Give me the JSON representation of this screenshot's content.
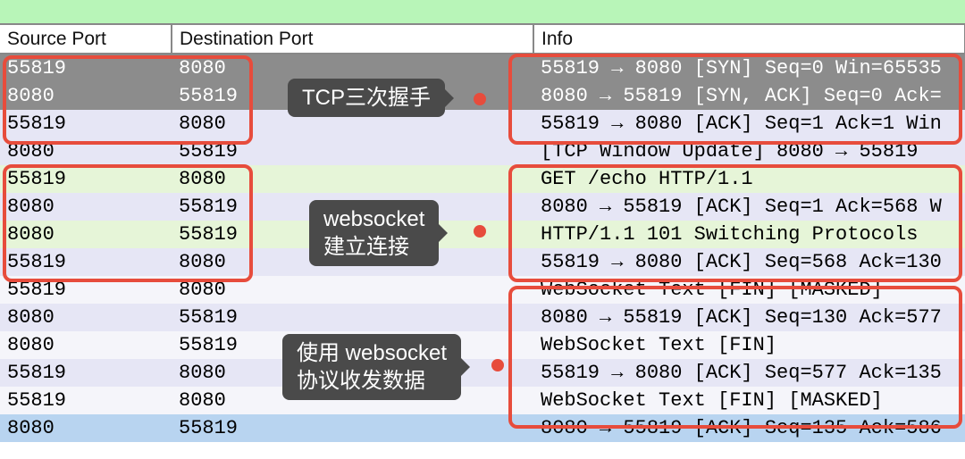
{
  "columns": {
    "src": "Source Port",
    "dst": "Destination Port",
    "info": "Info"
  },
  "rows": [
    {
      "src": "55819",
      "dst": "8080",
      "info": "55819 → 8080 [SYN] Seq=0 Win=65535",
      "cls": "selected"
    },
    {
      "src": "8080",
      "dst": "55819",
      "info": "8080 → 55819 [SYN, ACK] Seq=0 Ack=",
      "cls": "selected"
    },
    {
      "src": "55819",
      "dst": "8080",
      "info": "55819 → 8080 [ACK] Seq=1 Ack=1 Win",
      "cls": "light-lav"
    },
    {
      "src": "8080",
      "dst": "55819",
      "info": "[TCP Window Update] 8080 → 55819",
      "cls": "light-lav"
    },
    {
      "src": "55819",
      "dst": "8080",
      "info": "GET /echo HTTP/1.1",
      "cls": "light-green"
    },
    {
      "src": "8080",
      "dst": "55819",
      "info": "8080 → 55819 [ACK] Seq=1 Ack=568 W",
      "cls": "light-lav"
    },
    {
      "src": "8080",
      "dst": "55819",
      "info": "HTTP/1.1 101 Switching Protocols",
      "cls": "light-green"
    },
    {
      "src": "55819",
      "dst": "8080",
      "info": "55819 → 8080 [ACK] Seq=568 Ack=130",
      "cls": "light-lav"
    },
    {
      "src": "55819",
      "dst": "8080",
      "info": "WebSocket Text [FIN] [MASKED]",
      "cls": "alt"
    },
    {
      "src": "8080",
      "dst": "55819",
      "info": "8080 → 55819 [ACK] Seq=130 Ack=577",
      "cls": "light-lav"
    },
    {
      "src": "8080",
      "dst": "55819",
      "info": "WebSocket Text [FIN]",
      "cls": "alt"
    },
    {
      "src": "55819",
      "dst": "8080",
      "info": "55819 → 8080 [ACK] Seq=577 Ack=135",
      "cls": "light-lav"
    },
    {
      "src": "55819",
      "dst": "8080",
      "info": "WebSocket Text [FIN] [MASKED]",
      "cls": "alt"
    },
    {
      "src": "8080",
      "dst": "55819",
      "info": "8080 → 55819 [ACK] Seq=135 Ack=586",
      "cls": "blue"
    }
  ],
  "annotations": {
    "tcp_handshake": "TCP三次握手",
    "ws_connect": "websocket\n建立连接",
    "ws_data": "使用 websocket\n协议收发数据"
  }
}
